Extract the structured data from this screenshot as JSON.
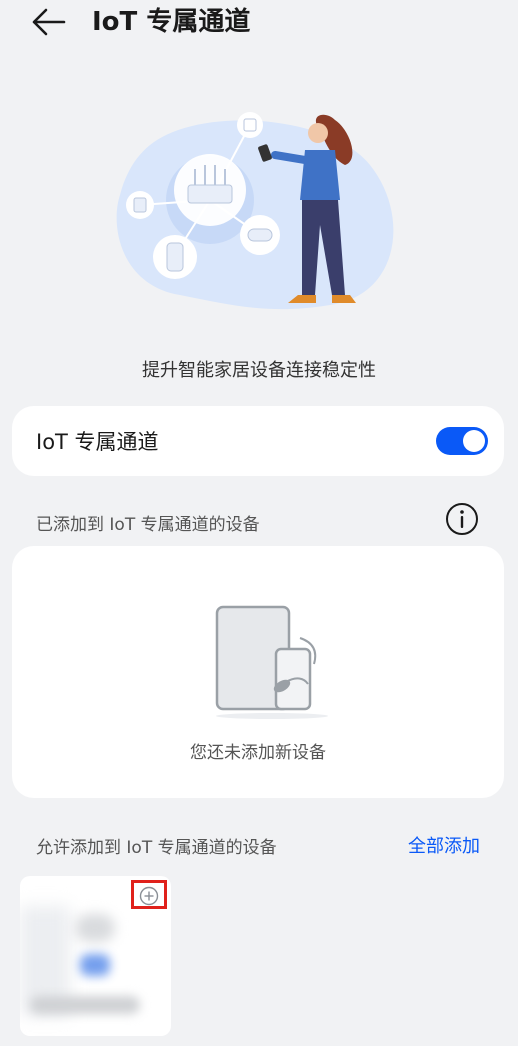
{
  "header": {
    "title": "IoT 专属通道"
  },
  "hero": {
    "caption": "提升智能家居设备连接稳定性"
  },
  "toggle_card": {
    "label": "IoT 专属通道",
    "enabled": true
  },
  "added_section": {
    "title": "已添加到 IoT 专属通道的设备",
    "empty_text": "您还未添加新设备"
  },
  "allowed_section": {
    "title": "允许添加到 IoT 专属通道的设备",
    "add_all": "全部添加"
  },
  "colors": {
    "accent": "#0a59f7",
    "highlight_box": "#e0211b",
    "background": "#f1f2f4"
  }
}
